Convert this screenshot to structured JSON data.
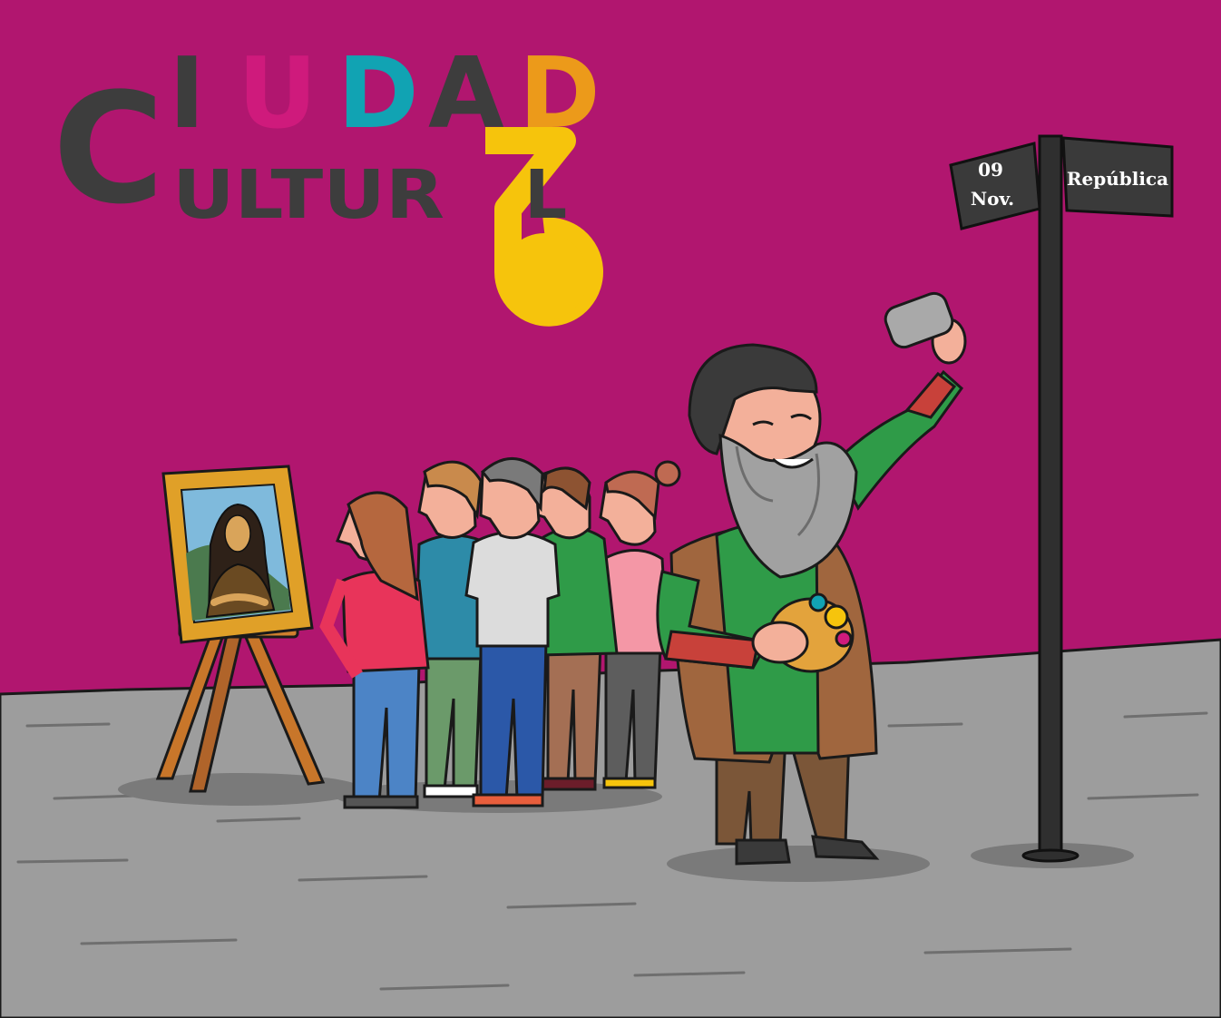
{
  "logo": {
    "line1_letters": [
      {
        "char": "C",
        "color": "#3d3d3d"
      },
      {
        "char": "I",
        "color": "#3d3d3d"
      },
      {
        "char": "U",
        "color": "#cf1a7c"
      },
      {
        "char": "D",
        "color": "#11a3b3"
      },
      {
        "char": "A",
        "color": "#3d3d3d"
      },
      {
        "char": "D",
        "color": "#ec9a1a"
      }
    ],
    "line2": "ULTUR",
    "line2_end": "L",
    "accent_yellow": "#f6c40c"
  },
  "sign": {
    "date_day": "09",
    "date_month": "Nov.",
    "street": "República"
  },
  "colors": {
    "background": "#b1166f",
    "ground": "#9d9d9d",
    "sign_board": "#3a3a3a",
    "outline": "#1a1a1a"
  }
}
